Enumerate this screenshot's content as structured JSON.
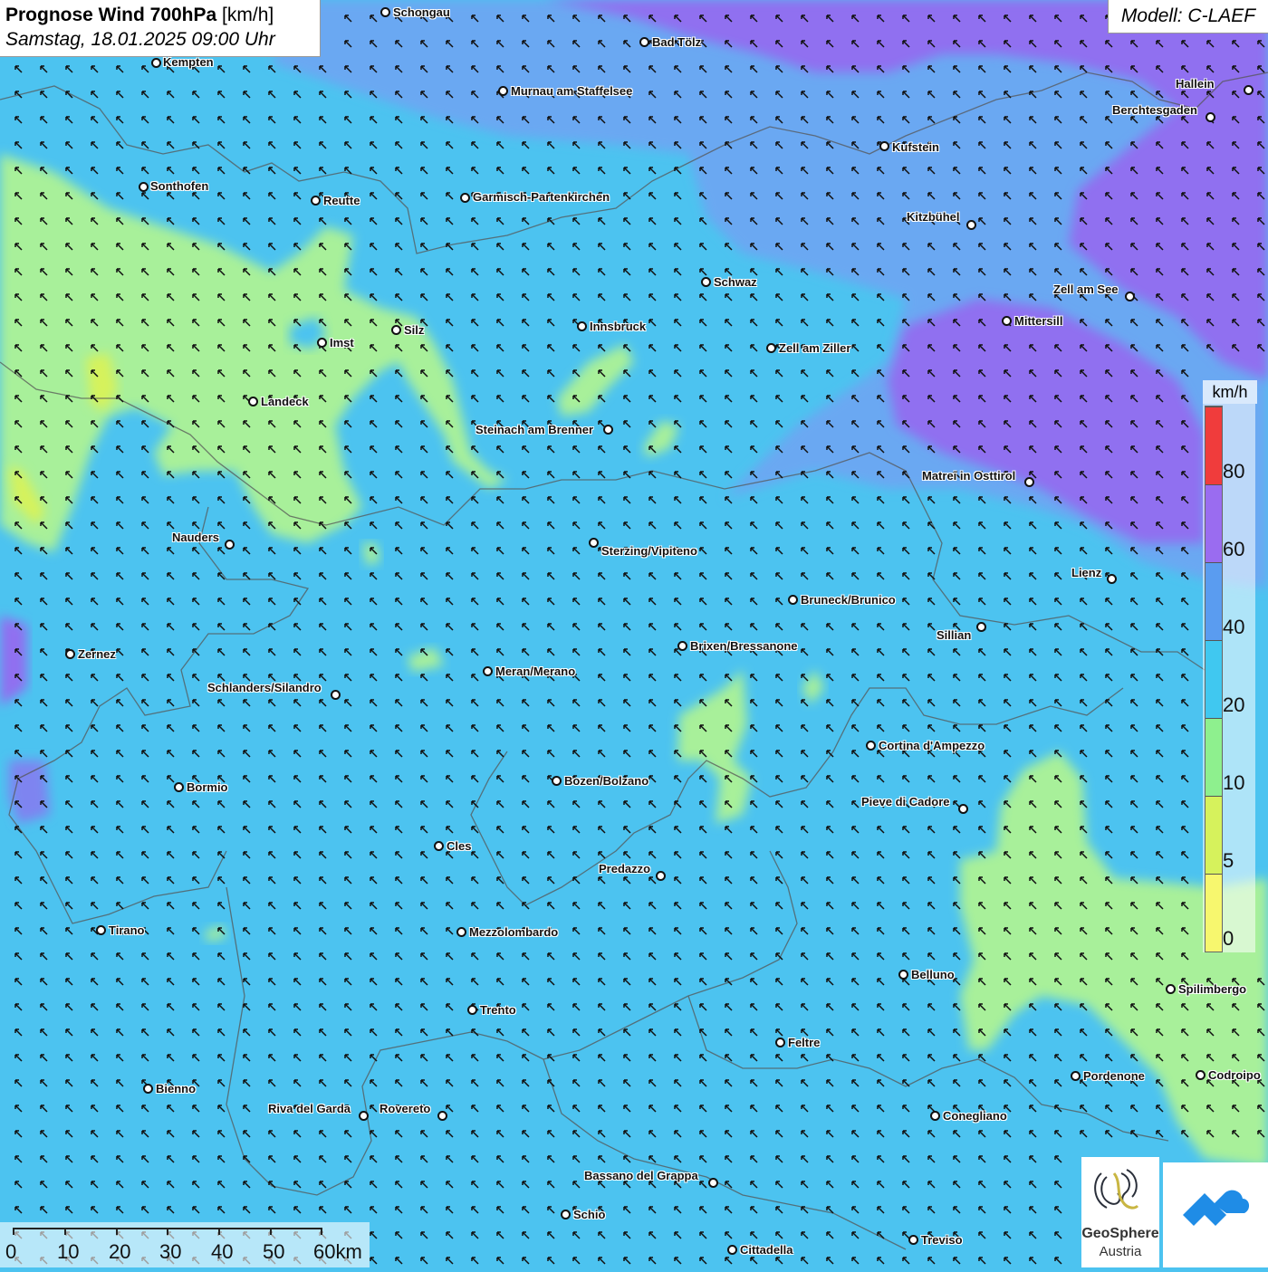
{
  "header": {
    "title_bold": "Prognose Wind 700hPa",
    "title_unit": "[km/h]",
    "subtitle": "Samstag, 18.01.2025 09:00 Uhr",
    "model": "Modell: C-LAEF"
  },
  "legend": {
    "unit": "km/h",
    "classes": [
      {
        "label": "0",
        "color": "#f7f76e"
      },
      {
        "label": "5",
        "color": "#d6f25c"
      },
      {
        "label": "10",
        "color": "#8ef08e"
      },
      {
        "label": "20",
        "color": "#40c8f0"
      },
      {
        "label": "40",
        "color": "#5a9cf0"
      },
      {
        "label": "60",
        "color": "#9a6cf0"
      },
      {
        "label": "80",
        "color": "#f03c3c"
      }
    ]
  },
  "scale_bar": {
    "labels": [
      "0",
      "10",
      "20",
      "30",
      "40",
      "50",
      "60km"
    ]
  },
  "colors": {
    "wind_blue": "#4cc3f0",
    "wind_green": "#a8f09a",
    "wind_violet": "#9070f0",
    "wind_mid_blue": "#6aa8f2"
  },
  "wind": {
    "arrow_direction": "north-west",
    "icon": "wind-arrow-icon"
  },
  "cities": [
    {
      "name": "Schongau"
    },
    {
      "name": "Bad Tölz"
    },
    {
      "name": "Kempten"
    },
    {
      "name": "Murnau am Staffelsee"
    },
    {
      "name": "Hallein"
    },
    {
      "name": "Berchtesgaden"
    },
    {
      "name": "Kufstein"
    },
    {
      "name": "Sonthofen"
    },
    {
      "name": "Reutte"
    },
    {
      "name": "Garmisch-Partenkirchen"
    },
    {
      "name": "Kitzbühel"
    },
    {
      "name": "Schwaz"
    },
    {
      "name": "Zell am See"
    },
    {
      "name": "Silz"
    },
    {
      "name": "Innsbruck"
    },
    {
      "name": "Mittersill"
    },
    {
      "name": "Imst"
    },
    {
      "name": "Zell am Ziller"
    },
    {
      "name": "Landeck"
    },
    {
      "name": "Steinach am Brenner"
    },
    {
      "name": "Matrei in Osttirol"
    },
    {
      "name": "Nauders"
    },
    {
      "name": "Sterzing/Vipiteno"
    },
    {
      "name": "Lienz"
    },
    {
      "name": "Bruneck/Brunico"
    },
    {
      "name": "Sillian"
    },
    {
      "name": "Zernez"
    },
    {
      "name": "Brixen/Bressanone"
    },
    {
      "name": "Meran/Merano"
    },
    {
      "name": "Schlanders/Silandro"
    },
    {
      "name": "Cortina d'Ampezzo"
    },
    {
      "name": "Bormio"
    },
    {
      "name": "Bozen/Bolzano"
    },
    {
      "name": "Pieve di Cadore"
    },
    {
      "name": "Cles"
    },
    {
      "name": "Predazzo"
    },
    {
      "name": "Tirano"
    },
    {
      "name": "Mezzolombardo"
    },
    {
      "name": "Belluno"
    },
    {
      "name": "Spilimbergo"
    },
    {
      "name": "Trento"
    },
    {
      "name": "Feltre"
    },
    {
      "name": "Pordenone"
    },
    {
      "name": "Codroipo"
    },
    {
      "name": "Bienno"
    },
    {
      "name": "Riva del Garda"
    },
    {
      "name": "Rovereto"
    },
    {
      "name": "Conegliano"
    },
    {
      "name": "Bassano del Grappa"
    },
    {
      "name": "Schio"
    },
    {
      "name": "Treviso"
    },
    {
      "name": "Cittadella"
    }
  ],
  "logos": {
    "geosphere_name": "GeoSphere",
    "geosphere_sub": "Austria"
  }
}
